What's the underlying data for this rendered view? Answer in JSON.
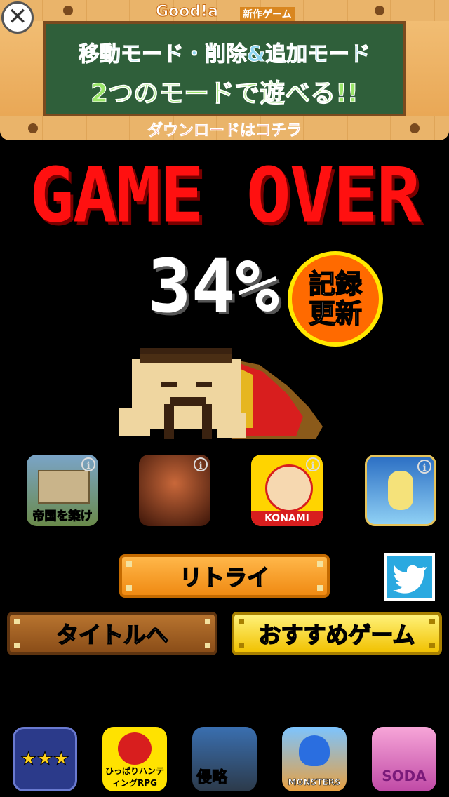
{
  "ad": {
    "brand": "Good!a",
    "brand_sub": "新作ゲーム",
    "line1": "移動モード・削除&追加モード",
    "line2": "2つのモードで遊べる!!",
    "cta": "ダウンロードはコチラ"
  },
  "result": {
    "title": "GAME OVER",
    "percent": "34%",
    "record_badge": "記録更新"
  },
  "apps": [
    {
      "name": "帝国を築け",
      "info": "i"
    },
    {
      "name": "",
      "info": "i"
    },
    {
      "name": "KONAMI",
      "info": "i"
    },
    {
      "name": "",
      "info": "i"
    }
  ],
  "buttons": {
    "retry": "リトライ",
    "title": "タイトルへ",
    "recommend": "おすすめゲーム"
  },
  "bottom_apps": [
    {
      "label": "★★★"
    },
    {
      "label": "ひっぱりハンティングRPG"
    },
    {
      "label": "侵略"
    },
    {
      "label": "MONSTERS"
    },
    {
      "label": "SODA"
    }
  ]
}
